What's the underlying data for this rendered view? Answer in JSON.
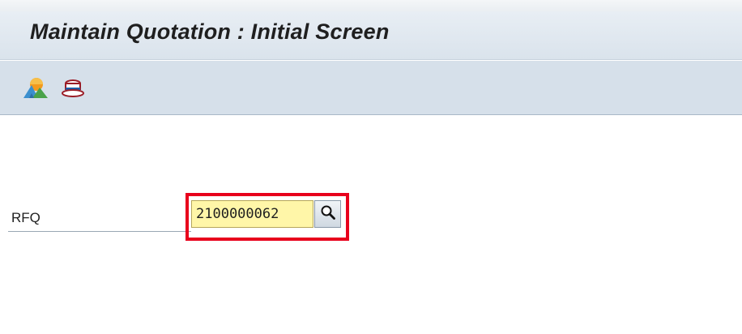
{
  "header": {
    "title": "Maintain Quotation : Initial Screen"
  },
  "toolbar": {
    "icons": [
      {
        "name": "other-document-icon"
      },
      {
        "name": "hold-data-icon"
      }
    ]
  },
  "form": {
    "rfq": {
      "label": "RFQ",
      "value": "2100000062"
    },
    "search_help": {
      "icon": "search-icon"
    }
  },
  "colors": {
    "highlight": "#e8001c",
    "input_background": "#fff6a8",
    "toolbar_background": "#d6e0ea"
  }
}
